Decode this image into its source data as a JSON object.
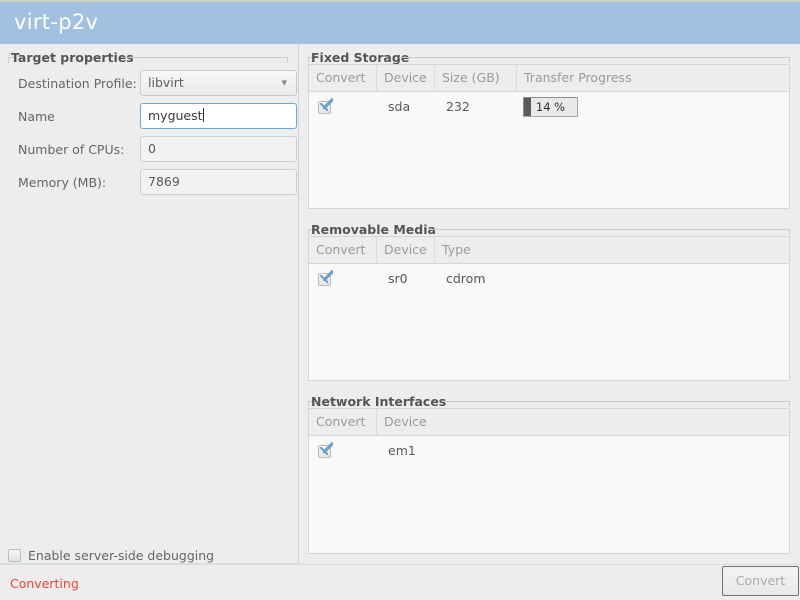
{
  "window": {
    "title": "virt-p2v"
  },
  "target_properties": {
    "frame_label": "Target properties",
    "fields": [
      {
        "label": "Destination Profile:",
        "value": "libvirt",
        "type": "combo",
        "icon": "chevron-down-icon"
      },
      {
        "label": "Name",
        "value": "myguest",
        "type": "text",
        "focused": true
      },
      {
        "label": "Number of CPUs:",
        "value": "0",
        "type": "text",
        "focused": false
      },
      {
        "label": "Memory (MB):",
        "value": "7869",
        "type": "text",
        "focused": false
      }
    ]
  },
  "fixed_storage": {
    "frame_label": "Fixed Storage",
    "columns": [
      "Convert",
      "Device",
      "Size (GB)",
      "Transfer Progress"
    ],
    "rows": [
      {
        "convert": true,
        "device": "sda",
        "size_gb": "232",
        "progress_text": "14 %",
        "progress_percent": 14
      }
    ]
  },
  "removable_media": {
    "frame_label": "Removable Media",
    "columns": [
      "Convert",
      "Device",
      "Type"
    ],
    "rows": [
      {
        "convert": true,
        "device": "sr0",
        "type": "cdrom"
      }
    ]
  },
  "network_interfaces": {
    "frame_label": "Network Interfaces",
    "columns": [
      "Convert",
      "Device"
    ],
    "rows": [
      {
        "convert": false,
        "device": "em1"
      }
    ]
  },
  "bottom": {
    "debug_checkbox_label": "Enable server-side debugging",
    "debug_checked": false,
    "status_text": "Converting",
    "convert_button_label": "Convert",
    "convert_button_enabled": false
  },
  "colors": {
    "titlebar": "#a2c0e0",
    "background": "#ededed",
    "status": "#ef4436",
    "accent_checkbox": "#6f9fd0",
    "focus_border": "#6ea6d9",
    "progress_fill": "#5b5b5b"
  }
}
